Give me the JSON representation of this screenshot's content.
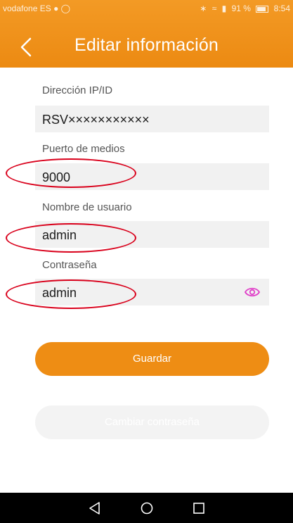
{
  "status": {
    "carrier": "vodafone ES",
    "battery": "91 %",
    "time": "8:54"
  },
  "header": {
    "title": "Editar información"
  },
  "form": {
    "ip_label": "Dirección IP/ID",
    "ip_value": "RSV×××××××××××",
    "port_label": "Puerto de medios",
    "port_value": "9000",
    "user_label": "Nombre de usuario",
    "user_value": "admin",
    "password_label": "Contraseña",
    "password_value": "admin"
  },
  "buttons": {
    "save": "Guardar",
    "change_password": "Cambiar contraseña"
  },
  "colors": {
    "accent": "#ee8d14",
    "highlight": "#d9001b",
    "eye": "#e040c8"
  },
  "icons": [
    "back-arrow-icon",
    "eye-icon",
    "nav-back-icon",
    "nav-home-icon",
    "nav-recents-icon"
  ]
}
